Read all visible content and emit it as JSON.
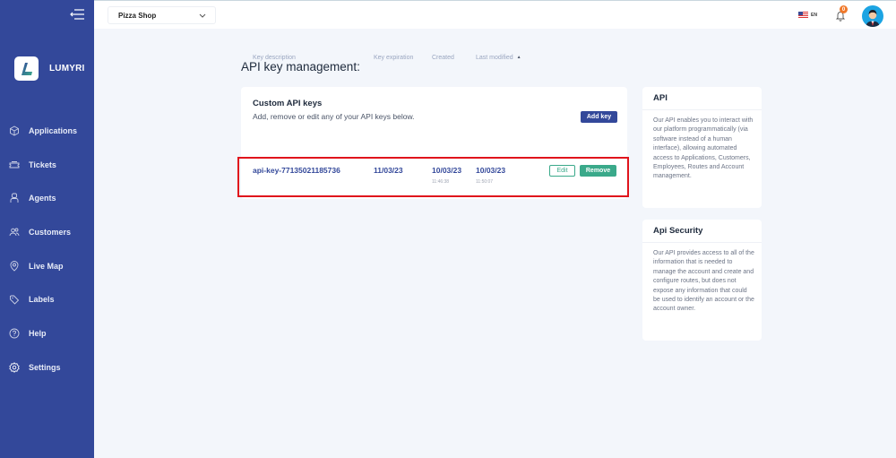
{
  "app": {
    "brand_name": "LUMYRI"
  },
  "sidebar": {
    "items": [
      {
        "label": "Applications",
        "icon": "box-icon"
      },
      {
        "label": "Tickets",
        "icon": "ticket-icon"
      },
      {
        "label": "Agents",
        "icon": "agent-icon"
      },
      {
        "label": "Customers",
        "icon": "users-icon"
      },
      {
        "label": "Live Map",
        "icon": "map-pin-icon"
      },
      {
        "label": "Labels",
        "icon": "tag-icon"
      },
      {
        "label": "Help",
        "icon": "help-icon"
      },
      {
        "label": "Settings",
        "icon": "gear-icon",
        "active": true
      }
    ]
  },
  "topbar": {
    "shop_selected": "Pizza Shop",
    "language": "EN",
    "notification_count": "0"
  },
  "main": {
    "page_title": "API key management:",
    "keys_card": {
      "title": "Custom API keys",
      "subtitle": "Add, remove or edit any of your API keys below.",
      "add_button": "Add key",
      "columns": [
        "Key description",
        "Key expiration",
        "Created",
        "Last modified"
      ],
      "rows": [
        {
          "description": "api-key-77135021185736",
          "expiration": "11/03/23",
          "created_date": "10/03/23",
          "created_time": "11:46:38",
          "modified_date": "10/03/23",
          "modified_time": "11:50:07",
          "edit_label": "Edit",
          "remove_label": "Remove"
        }
      ]
    },
    "info_cards": [
      {
        "title": "API",
        "body": "Our API enables you to interact with our platform programmatically (via software instead of a human interface), allowing automated access to Applications, Customers, Employees, Routes and Account management."
      },
      {
        "title": "Api Security",
        "body": "Our API provides access to all of the information that is needed to manage the account and create and configure routes, but does not expose any information that could be used to identify an account or the account owner."
      }
    ]
  },
  "colors": {
    "sidebar": "#33489a",
    "accent": "#33489a",
    "success": "#3aa98a",
    "highlight": "#e0141c",
    "badge": "#f0792b"
  }
}
